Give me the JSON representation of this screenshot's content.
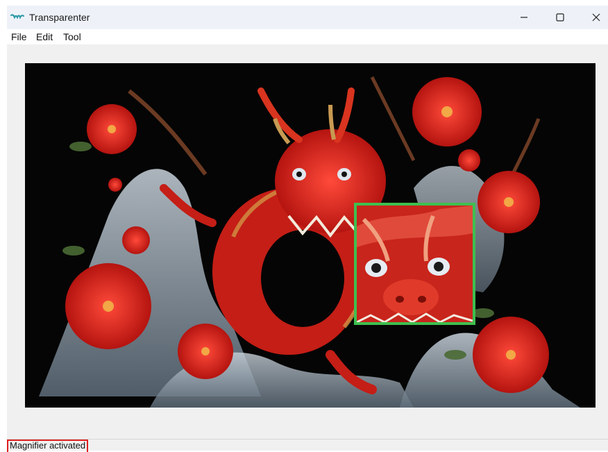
{
  "window": {
    "title": "Transparenter",
    "app_icon": "transparenter-logo-icon",
    "controls": {
      "minimize_icon": "minimize-icon",
      "maximize_icon": "maximize-icon",
      "close_icon": "close-icon"
    }
  },
  "menu": {
    "items": [
      {
        "label": "File"
      },
      {
        "label": "Edit"
      },
      {
        "label": "Tool"
      }
    ]
  },
  "canvas": {
    "image_description_icon": "dragon-image",
    "magnifier_border_color": "#3fbf4f"
  },
  "status": {
    "text": "Magnifier activated",
    "highlight_color": "#e02020"
  }
}
